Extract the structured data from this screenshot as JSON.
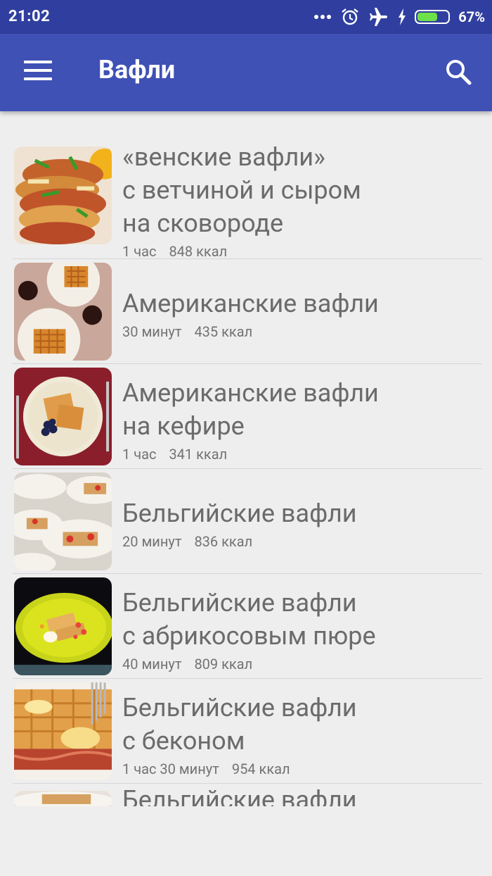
{
  "status_bar": {
    "time": "21:02",
    "battery_percent": "67%",
    "battery_level": 0.67,
    "icons": [
      "more-dots-icon",
      "alarm-icon",
      "airplane-mode-icon",
      "charging-icon",
      "battery-icon"
    ]
  },
  "app_bar": {
    "title": "Вафли",
    "menu_icon": "hamburger-menu-icon",
    "search_icon": "search-icon",
    "color": "#3f51b5",
    "status_color": "#303f9f"
  },
  "recipes": [
    {
      "title_lines": [
        "«венские вафли»",
        "с ветчиной и сыром",
        "на сковороде"
      ],
      "time": "1 час",
      "calories": "848 ккал"
    },
    {
      "title_lines": [
        "Американские вафли"
      ],
      "time": "30 минут",
      "calories": "435 ккал"
    },
    {
      "title_lines": [
        "Американские вафли",
        "на кефире"
      ],
      "time": "1 час",
      "calories": "341 ккал"
    },
    {
      "title_lines": [
        "Бельгийские вафли"
      ],
      "time": "20 минут",
      "calories": "836 ккал"
    },
    {
      "title_lines": [
        "Бельгийские вафли",
        "с абрикосовым пюре"
      ],
      "time": "40 минут",
      "calories": "809 ккал"
    },
    {
      "title_lines": [
        "Бельгийские вафли",
        "с беконом"
      ],
      "time": "1 час 30 минут",
      "calories": "954 ккал"
    },
    {
      "title_lines": [
        "Бельгийские вафли"
      ],
      "time": "",
      "calories": ""
    }
  ]
}
